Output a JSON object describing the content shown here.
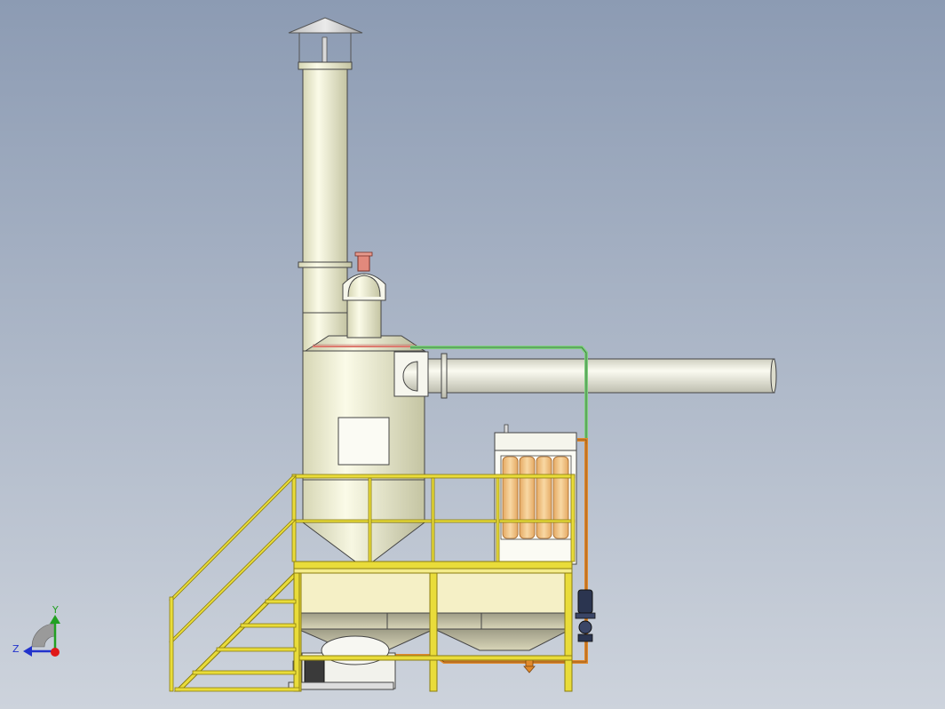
{
  "viewport": {
    "background_top": "#8c9bb3",
    "background_bottom": "#cdd3dc"
  },
  "triad": {
    "x_label": "",
    "y_label": "Y",
    "z_label": "Z",
    "y_color": "#22a022",
    "z_color": "#2233cc",
    "origin_color": "#e01818"
  },
  "colors": {
    "vessel": "#f1f1d4",
    "vessel_shade": "#c8c8a6",
    "duct": "#ececde",
    "frame": "#e9dc3a",
    "frame_edge": "#8a7d10",
    "hopper": "#f5f0c6",
    "hopper_shade": "#b9b69a",
    "filter_cartridge": "#f2c27e",
    "orange_pipe": "#e18a2c",
    "green_pipe": "#7fd17f",
    "red_pipe": "#dd7a6e",
    "pump": "#2b3550",
    "outline": "#3a3a3a"
  }
}
